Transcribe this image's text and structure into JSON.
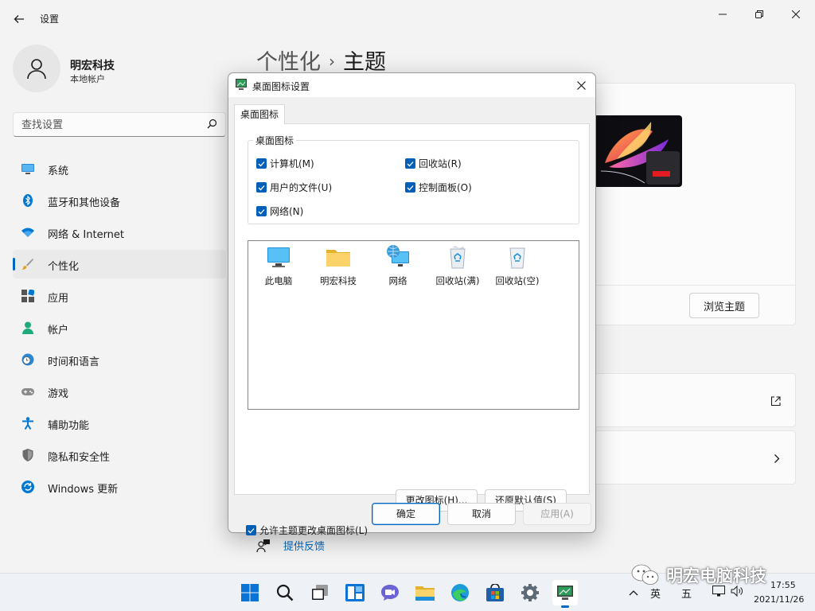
{
  "window": {
    "app_title": "设置",
    "profile": {
      "name": "明宏科技",
      "account_type": "本地帐户"
    },
    "search": {
      "placeholder": "查找设置"
    },
    "nav_items": [
      {
        "label": "系统",
        "icon": "monitor-icon"
      },
      {
        "label": "蓝牙和其他设备",
        "icon": "bluetooth-icon"
      },
      {
        "label": "网络 & Internet",
        "icon": "wifi-icon"
      },
      {
        "label": "个性化",
        "icon": "brush-icon",
        "active": true
      },
      {
        "label": "应用",
        "icon": "apps-icon"
      },
      {
        "label": "帐户",
        "icon": "person-icon"
      },
      {
        "label": "时间和语言",
        "icon": "clock-globe-icon"
      },
      {
        "label": "游戏",
        "icon": "gamepad-icon"
      },
      {
        "label": "辅助功能",
        "icon": "accessibility-icon"
      },
      {
        "label": "隐私和安全性",
        "icon": "shield-icon"
      },
      {
        "label": "Windows 更新",
        "icon": "update-icon"
      }
    ],
    "breadcrumb": {
      "parent": "个性化",
      "separator": "›",
      "current": "主题"
    },
    "browse_theme_label": "浏览主题",
    "feedback_label": "提供反馈"
  },
  "dialog": {
    "title": "桌面图标设置",
    "tab_label": "桌面图标",
    "group_label": "桌面图标",
    "checkboxes": [
      {
        "label": "计算机(M)",
        "checked": true
      },
      {
        "label": "回收站(R)",
        "checked": true
      },
      {
        "label": "用户的文件(U)",
        "checked": true
      },
      {
        "label": "控制面板(O)",
        "checked": true
      },
      {
        "label": "网络(N)",
        "checked": true
      }
    ],
    "icons": [
      {
        "label": "此电脑",
        "icon": "computer-icon"
      },
      {
        "label": "明宏科技",
        "icon": "folder-icon"
      },
      {
        "label": "网络",
        "icon": "network-icon"
      },
      {
        "label": "回收站(满)",
        "icon": "recycle-bin-full-icon"
      },
      {
        "label": "回收站(空)",
        "icon": "recycle-bin-empty-icon"
      }
    ],
    "change_icon_label": "更改图标(H)...",
    "restore_default_label": "还原默认值(S)",
    "allow_theme_label": "允许主题更改桌面图标(L)",
    "allow_theme_checked": true,
    "ok_label": "确定",
    "cancel_label": "取消",
    "apply_label": "应用(A)"
  },
  "taskbar": {
    "apps": [
      "start-icon",
      "search-icon",
      "task-view-icon",
      "widgets-icon",
      "chat-icon",
      "file-explorer-icon",
      "edge-icon",
      "store-icon",
      "settings-icon",
      "desktop-icon-settings-icon"
    ],
    "tray": {
      "lang": "英",
      "ime": "五"
    },
    "clock": {
      "time": "17:55",
      "date": "2021/11/26"
    }
  },
  "watermark": "明宏电脑科技",
  "colors": {
    "accent": "#0067c0",
    "checkbox": "#005fb8",
    "link": "#0067c0"
  }
}
